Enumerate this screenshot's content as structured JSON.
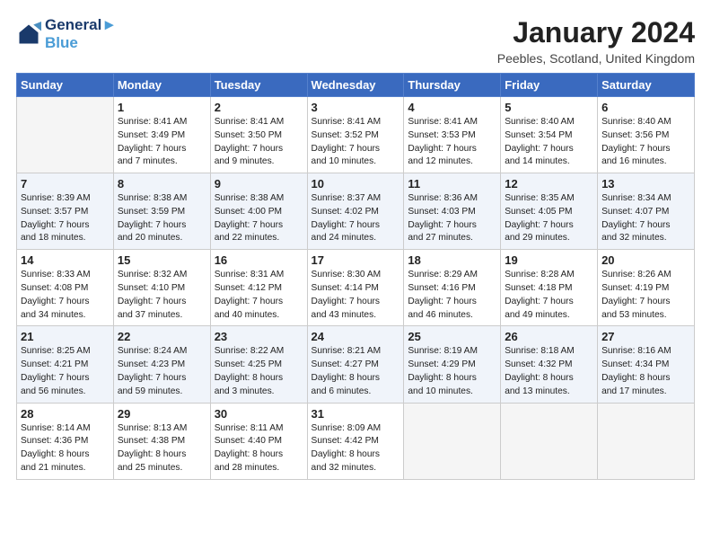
{
  "header": {
    "logo_line1": "General",
    "logo_line2": "Blue",
    "month_title": "January 2024",
    "location": "Peebles, Scotland, United Kingdom"
  },
  "days_of_week": [
    "Sunday",
    "Monday",
    "Tuesday",
    "Wednesday",
    "Thursday",
    "Friday",
    "Saturday"
  ],
  "weeks": [
    [
      {
        "day": "",
        "info": ""
      },
      {
        "day": "1",
        "info": "Sunrise: 8:41 AM\nSunset: 3:49 PM\nDaylight: 7 hours\nand 7 minutes."
      },
      {
        "day": "2",
        "info": "Sunrise: 8:41 AM\nSunset: 3:50 PM\nDaylight: 7 hours\nand 9 minutes."
      },
      {
        "day": "3",
        "info": "Sunrise: 8:41 AM\nSunset: 3:52 PM\nDaylight: 7 hours\nand 10 minutes."
      },
      {
        "day": "4",
        "info": "Sunrise: 8:41 AM\nSunset: 3:53 PM\nDaylight: 7 hours\nand 12 minutes."
      },
      {
        "day": "5",
        "info": "Sunrise: 8:40 AM\nSunset: 3:54 PM\nDaylight: 7 hours\nand 14 minutes."
      },
      {
        "day": "6",
        "info": "Sunrise: 8:40 AM\nSunset: 3:56 PM\nDaylight: 7 hours\nand 16 minutes."
      }
    ],
    [
      {
        "day": "7",
        "info": "Sunrise: 8:39 AM\nSunset: 3:57 PM\nDaylight: 7 hours\nand 18 minutes."
      },
      {
        "day": "8",
        "info": "Sunrise: 8:38 AM\nSunset: 3:59 PM\nDaylight: 7 hours\nand 20 minutes."
      },
      {
        "day": "9",
        "info": "Sunrise: 8:38 AM\nSunset: 4:00 PM\nDaylight: 7 hours\nand 22 minutes."
      },
      {
        "day": "10",
        "info": "Sunrise: 8:37 AM\nSunset: 4:02 PM\nDaylight: 7 hours\nand 24 minutes."
      },
      {
        "day": "11",
        "info": "Sunrise: 8:36 AM\nSunset: 4:03 PM\nDaylight: 7 hours\nand 27 minutes."
      },
      {
        "day": "12",
        "info": "Sunrise: 8:35 AM\nSunset: 4:05 PM\nDaylight: 7 hours\nand 29 minutes."
      },
      {
        "day": "13",
        "info": "Sunrise: 8:34 AM\nSunset: 4:07 PM\nDaylight: 7 hours\nand 32 minutes."
      }
    ],
    [
      {
        "day": "14",
        "info": "Sunrise: 8:33 AM\nSunset: 4:08 PM\nDaylight: 7 hours\nand 34 minutes."
      },
      {
        "day": "15",
        "info": "Sunrise: 8:32 AM\nSunset: 4:10 PM\nDaylight: 7 hours\nand 37 minutes."
      },
      {
        "day": "16",
        "info": "Sunrise: 8:31 AM\nSunset: 4:12 PM\nDaylight: 7 hours\nand 40 minutes."
      },
      {
        "day": "17",
        "info": "Sunrise: 8:30 AM\nSunset: 4:14 PM\nDaylight: 7 hours\nand 43 minutes."
      },
      {
        "day": "18",
        "info": "Sunrise: 8:29 AM\nSunset: 4:16 PM\nDaylight: 7 hours\nand 46 minutes."
      },
      {
        "day": "19",
        "info": "Sunrise: 8:28 AM\nSunset: 4:18 PM\nDaylight: 7 hours\nand 49 minutes."
      },
      {
        "day": "20",
        "info": "Sunrise: 8:26 AM\nSunset: 4:19 PM\nDaylight: 7 hours\nand 53 minutes."
      }
    ],
    [
      {
        "day": "21",
        "info": "Sunrise: 8:25 AM\nSunset: 4:21 PM\nDaylight: 7 hours\nand 56 minutes."
      },
      {
        "day": "22",
        "info": "Sunrise: 8:24 AM\nSunset: 4:23 PM\nDaylight: 7 hours\nand 59 minutes."
      },
      {
        "day": "23",
        "info": "Sunrise: 8:22 AM\nSunset: 4:25 PM\nDaylight: 8 hours\nand 3 minutes."
      },
      {
        "day": "24",
        "info": "Sunrise: 8:21 AM\nSunset: 4:27 PM\nDaylight: 8 hours\nand 6 minutes."
      },
      {
        "day": "25",
        "info": "Sunrise: 8:19 AM\nSunset: 4:29 PM\nDaylight: 8 hours\nand 10 minutes."
      },
      {
        "day": "26",
        "info": "Sunrise: 8:18 AM\nSunset: 4:32 PM\nDaylight: 8 hours\nand 13 minutes."
      },
      {
        "day": "27",
        "info": "Sunrise: 8:16 AM\nSunset: 4:34 PM\nDaylight: 8 hours\nand 17 minutes."
      }
    ],
    [
      {
        "day": "28",
        "info": "Sunrise: 8:14 AM\nSunset: 4:36 PM\nDaylight: 8 hours\nand 21 minutes."
      },
      {
        "day": "29",
        "info": "Sunrise: 8:13 AM\nSunset: 4:38 PM\nDaylight: 8 hours\nand 25 minutes."
      },
      {
        "day": "30",
        "info": "Sunrise: 8:11 AM\nSunset: 4:40 PM\nDaylight: 8 hours\nand 28 minutes."
      },
      {
        "day": "31",
        "info": "Sunrise: 8:09 AM\nSunset: 4:42 PM\nDaylight: 8 hours\nand 32 minutes."
      },
      {
        "day": "",
        "info": ""
      },
      {
        "day": "",
        "info": ""
      },
      {
        "day": "",
        "info": ""
      }
    ]
  ]
}
